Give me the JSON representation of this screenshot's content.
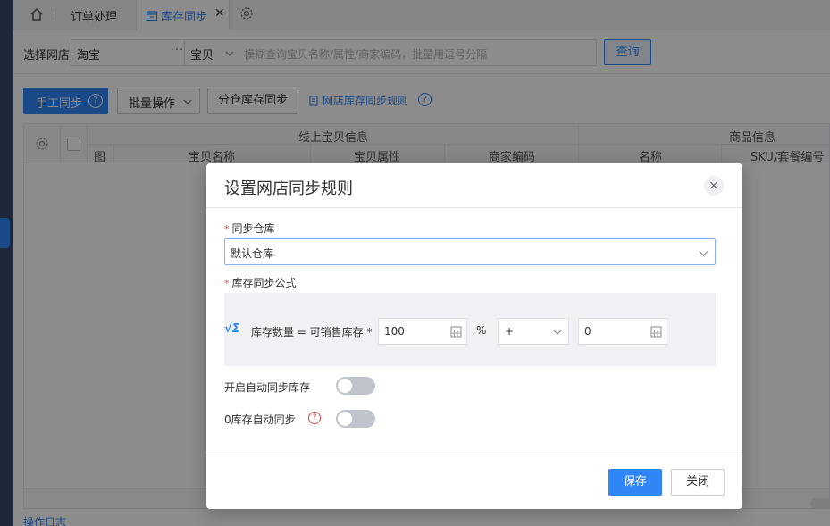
{
  "tabs": {
    "order_label": "订单处理",
    "active_label": "库存同步",
    "close_glyph": "✕"
  },
  "filter": {
    "shop_label": "选择网店",
    "shop_value": "淘宝",
    "shop_more": "···",
    "search_type": "宝贝",
    "search_placeholder": "模糊查询宝贝名称/属性/商家编码，批量用逗号分隔",
    "query_button": "查询"
  },
  "toolbar": {
    "manual_sync": "手工同步",
    "manual_help": "?",
    "batch_ops": "批量操作",
    "split_sync": "分仓库存同步",
    "rule_link": "网店库存同步规则",
    "rule_help": "?"
  },
  "grid": {
    "group_online": "线上宝贝信息",
    "group_goods": "商品信息",
    "col_image": "图",
    "col_name": "宝贝名称",
    "col_attr": "宝贝属性",
    "col_code": "商家编码",
    "col_goods_name": "名称",
    "col_sku": "SKU/套餐编号"
  },
  "footer": {
    "log_link": "操作日志"
  },
  "dialog": {
    "title": "设置网店同步规则",
    "close_glyph": "×",
    "warehouse_label": "同步仓库",
    "warehouse_value": "默认仓库",
    "formula_label": "库存同步公式",
    "formula_icon": "√Σ",
    "formula_text": "库存数量 = 可销售库存 *",
    "percent_value": "100",
    "percent_sign": "%",
    "operator": "+",
    "offset_value": "0",
    "auto_sync_label": "开启自动同步库存",
    "auto_sync_on": false,
    "zero_sync_label": "0库存自动同步",
    "zero_sync_help": "?",
    "zero_sync_on": false,
    "save_button": "保存",
    "close_button": "关闭"
  },
  "colors": {
    "accent": "#2f86f6",
    "sidebar": "#3a4a66",
    "required": "#e04444"
  }
}
